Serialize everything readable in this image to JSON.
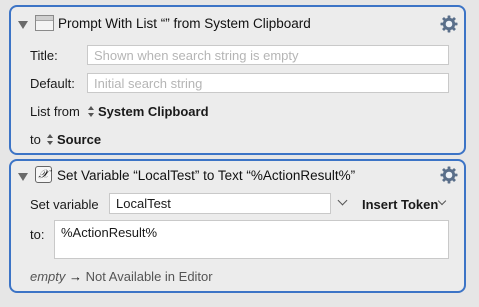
{
  "action1": {
    "title": "Prompt With List “” from System Clipboard",
    "title_label": "Title:",
    "title_placeholder": "Shown when search string is empty",
    "default_label": "Default:",
    "default_placeholder": "Initial search string",
    "list_from_label": "List from",
    "list_from_value": "System Clipboard",
    "to_label": "to",
    "to_value": "Source"
  },
  "action2": {
    "icon_glyph": "𝒳",
    "title": "Set Variable “LocalTest” to Text “%ActionResult%”",
    "set_variable_label": "Set variable",
    "variable_value": "LocalTest",
    "insert_token_label": "Insert Token",
    "to_label": "to:",
    "text_value": "%ActionResult%",
    "footer_empty": "empty",
    "footer_arrow": "→",
    "footer_text": "Not Available in Editor"
  },
  "colors": {
    "selection_border": "#3c74c6",
    "gear": "#5a6f8a"
  }
}
